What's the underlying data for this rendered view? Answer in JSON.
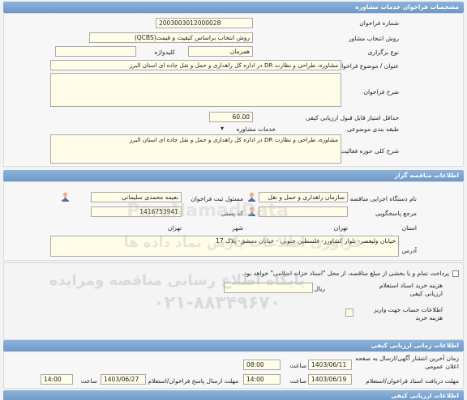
{
  "sections": {
    "tender": "مشخصات فراخوان خدمات مشاوره",
    "organizer": "اطلاعات مناقصه گزار",
    "timing": "اطلاعات زمانی ارزیابی کیفی",
    "timing_next": "اطلاعات ارزیابی کیفی"
  },
  "tender": {
    "number_label": "شماره فراخوان",
    "number_value": "2003003012000028",
    "method_label": "روش انتخاب مشاور",
    "method_value": "روش انتخاب براساس کیفیت و قیمت(QCBS)",
    "type_label": "نوع برگزاری",
    "type_value": "همزمان",
    "keyword_label": "کلیدواژه",
    "subject_label": "عنوان / موضوع فراخوان",
    "subject_value": "مشاوره، طراحی و نظارت DR در اداره کل راهداری و حمل و نقل جاده ای استان البرز",
    "description_label": "شرح فراخوان",
    "min_score_label": "حداقل امتیاز قابل قبول ارزیابی کیفی",
    "min_score_value": "60.00",
    "category_label": "طبقه بندی موضوعی",
    "category_value": "خدمات مشاوره",
    "scope_label": "شرح کلی حوزه فعالیت",
    "scope_value": "مشاوره، طراحی و نظارت DR در اداره کل راهداری و حمل و نقل جاده ای استان البرز"
  },
  "organizer": {
    "agency_label": "نام دستگاه اجرایی مناقصه گزار",
    "agency_value": "سازمان راهداری و حمل و نقل",
    "registrar_label": "مسئول ثبت فراخوان",
    "registrar_value": "نعیمه محمدی سلیمانی",
    "reference_label": "مرجع پاسخگویی",
    "postal_label": "کد پستی",
    "postal_value": "1416753941",
    "province_label": "استان",
    "province_value": "تهران",
    "city_label": "شهر",
    "city_value": "تهران",
    "address_label": "آدرس",
    "address_value": "خیابان ولیعصر- بلوار کشاورز- فلسطین جنوبی - خیابان دمشق- پلاک 17"
  },
  "fees": {
    "note": "پرداخت تمام و یا بخشی از مبلغ مناقصه، از محل \"اسناد خزانه اسلامی\" خواهد بود.",
    "doc_fee_label": "هزینه خرید اسناد استعلام ارزیابی کیفی",
    "currency": "ریال",
    "account_label": "اطلاعات حساب جهت واریز هزینه خرید"
  },
  "timing": {
    "publish_label": "زمان آخرین انتشار آگهی/ارسال به صفحه اعلان عمومی",
    "publish_date": "1403/06/11",
    "publish_time": "08:00",
    "receive_deadline_label": "مهلت دریافت اسناد فراخوان/استعلام",
    "receive_date": "1403/06/19",
    "receive_time": "14:00",
    "response_deadline_label": "مهلت ارسال پاسخ فراخوان/استعلام",
    "response_date": "1403/06/27",
    "response_time": "14:00",
    "time_label": "ساعت"
  },
  "watermark": {
    "line1": "پایگاه اطلاع رسانی مناقصه ومزایده",
    "line2": "۰۲۱-۸۸۳۴۹۶۷۰",
    "line3": "ParsNamadData",
    "line4": "فرآوری اطلاعات پارس نماد داده ها"
  },
  "colors": {
    "header": "#7aa3cf",
    "field": "#fffde8",
    "border": "#a9a9a9"
  }
}
